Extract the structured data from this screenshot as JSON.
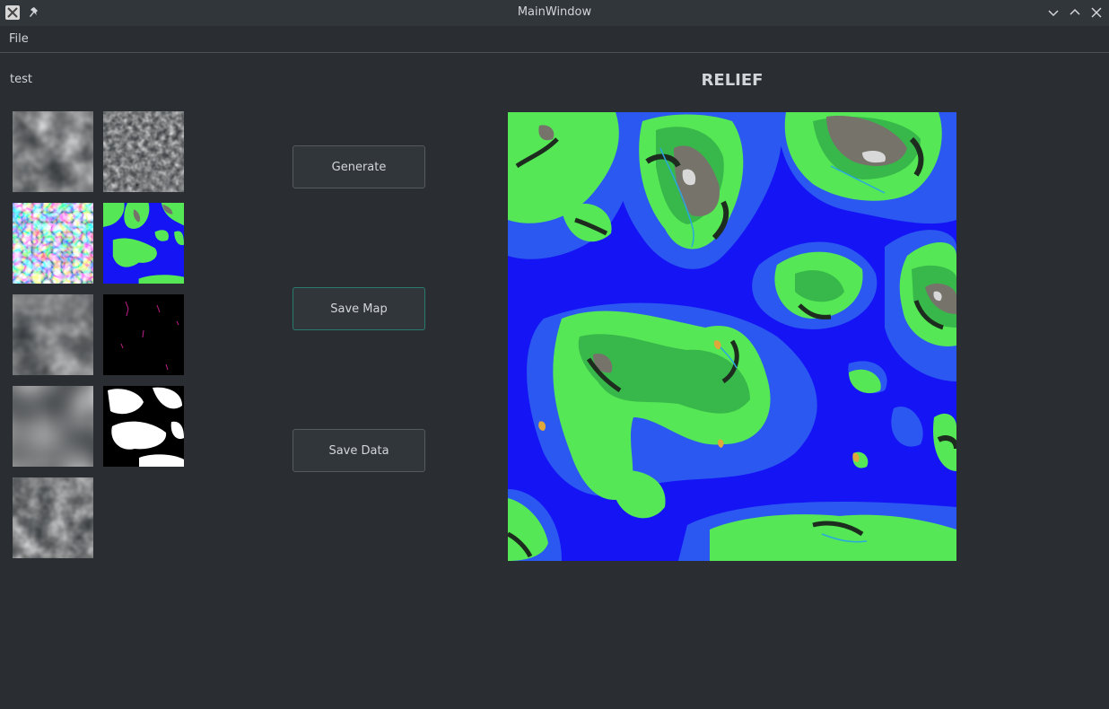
{
  "window": {
    "title": "MainWindow"
  },
  "menu": {
    "items": [
      "File"
    ]
  },
  "left_label": "test",
  "buttons": {
    "generate": "Generate",
    "save_map": "Save Map",
    "save_data": "Save Data"
  },
  "relief_title": "RELIEF",
  "icons": [
    "app-icon",
    "pin-icon",
    "minimize-icon",
    "maximize-icon",
    "close-icon"
  ],
  "colors": {
    "deep_water": "#1414f5",
    "shallow_water": "#2b58f0",
    "lowland": "#55e755",
    "highland": "#38b84a",
    "mountain": "#76746a",
    "snow": "#d8d8d8",
    "sand": "#e0a83a"
  }
}
